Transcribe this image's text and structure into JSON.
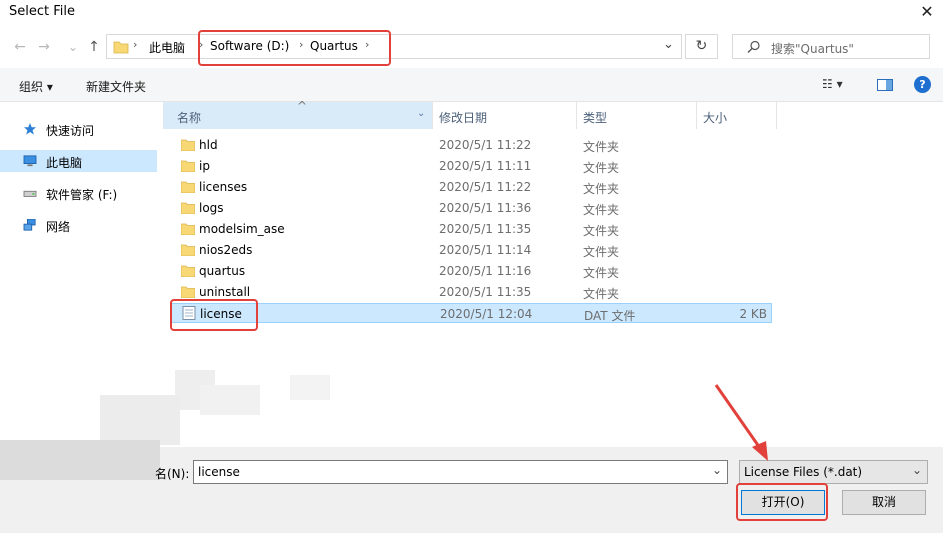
{
  "window": {
    "title": "Select File",
    "close_glyph": "✕"
  },
  "nav": {
    "back_glyph": "←",
    "forward_glyph": "→",
    "history_glyph": "⌄",
    "up_glyph": "↑",
    "breadcrumb": [
      "此电脑",
      "Software (D:)",
      "Quartus"
    ],
    "separator": "›",
    "address_dropdown_glyph": "⌄",
    "refresh_glyph": "↻",
    "search_placeholder": "搜索\"Quartus\""
  },
  "toolbar": {
    "organize_label": "组织 ▾",
    "new_folder_label": "新建文件夹",
    "view_glyph": "☷ ▾",
    "help_glyph": "?"
  },
  "sidebar": {
    "items": [
      {
        "label": "快速访问",
        "icon": "star-icon",
        "selected": false
      },
      {
        "label": "此电脑",
        "icon": "computer-icon",
        "selected": true
      },
      {
        "label": "软件管家 (F:)",
        "icon": "drive-icon",
        "selected": false
      },
      {
        "label": "网络",
        "icon": "network-icon",
        "selected": false
      }
    ]
  },
  "columns": {
    "name": "名称",
    "date": "修改日期",
    "type": "类型",
    "size": "大小",
    "sort_glyph": "^"
  },
  "files": [
    {
      "name": "hld",
      "date": "2020/5/1 11:22",
      "type": "文件夹",
      "size": "",
      "kind": "folder"
    },
    {
      "name": "ip",
      "date": "2020/5/1 11:11",
      "type": "文件夹",
      "size": "",
      "kind": "folder"
    },
    {
      "name": "licenses",
      "date": "2020/5/1 11:22",
      "type": "文件夹",
      "size": "",
      "kind": "folder"
    },
    {
      "name": "logs",
      "date": "2020/5/1 11:36",
      "type": "文件夹",
      "size": "",
      "kind": "folder"
    },
    {
      "name": "modelsim_ase",
      "date": "2020/5/1 11:35",
      "type": "文件夹",
      "size": "",
      "kind": "folder"
    },
    {
      "name": "nios2eds",
      "date": "2020/5/1 11:14",
      "type": "文件夹",
      "size": "",
      "kind": "folder"
    },
    {
      "name": "quartus",
      "date": "2020/5/1 11:16",
      "type": "文件夹",
      "size": "",
      "kind": "folder"
    },
    {
      "name": "uninstall",
      "date": "2020/5/1 11:35",
      "type": "文件夹",
      "size": "",
      "kind": "folder"
    },
    {
      "name": "license",
      "date": "2020/5/1 12:04",
      "type": "DAT 文件",
      "size": "2 KB",
      "kind": "file"
    }
  ],
  "footer": {
    "filename_label": "名(N):",
    "filename_value": "license",
    "filter_value": "License Files (*.dat)",
    "open_label": "打开(O)",
    "cancel_label": "取消"
  },
  "colors": {
    "selection": "#cce8ff",
    "annotation": "#e2413b",
    "folder": "#f8d775"
  }
}
